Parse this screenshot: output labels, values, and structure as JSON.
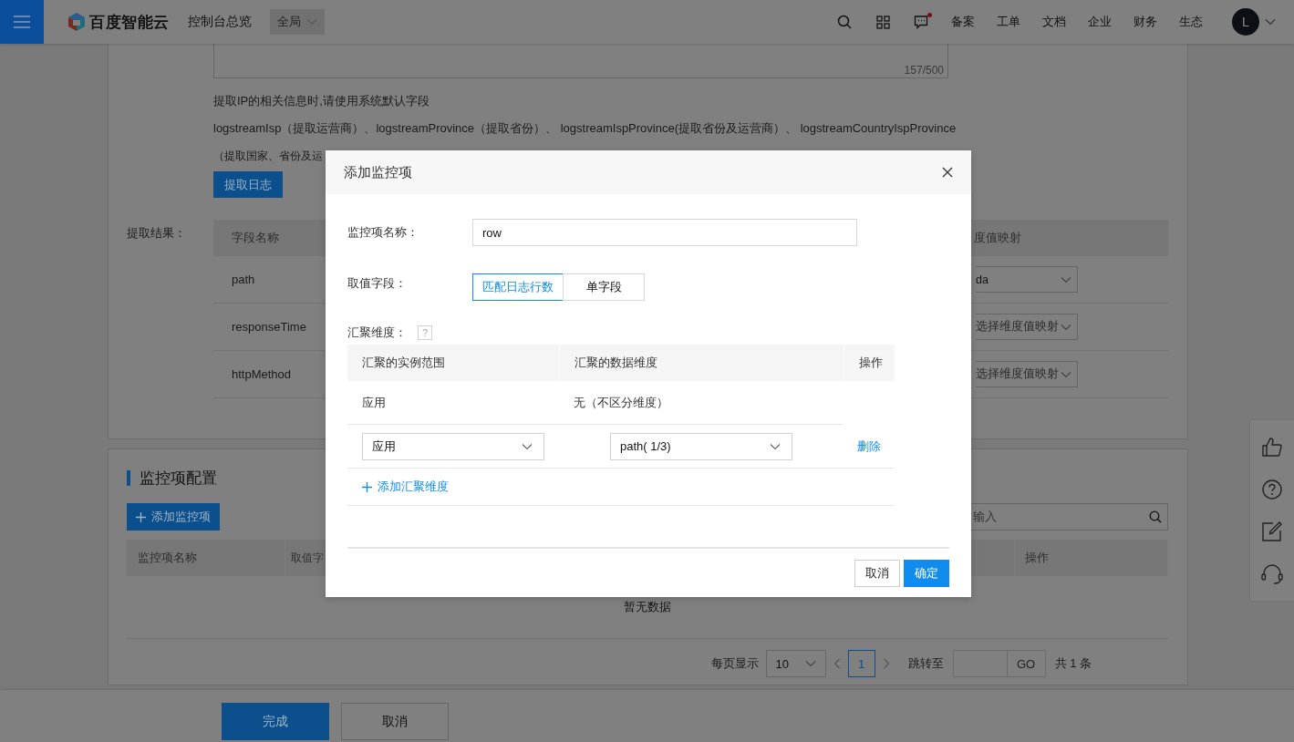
{
  "topbar": {
    "brand": "百度智能云",
    "title": "控制台总览",
    "scope": "全局",
    "notification_dot": true,
    "links": [
      "备案",
      "工单",
      "文档",
      "企业",
      "财务",
      "生态"
    ],
    "avatar": "L"
  },
  "log_form": {
    "char_count": "157/500",
    "hint": "提取IP的相关信息时,请使用系统默认字段",
    "fields_line": "logstreamIsp（提取运营商）、logstreamProvince（提取省份）、 logstreamIspProvince(提取省份及运营商）、 logstreamCountryIspProvince",
    "fields_line_2": "（提取国家、省份及运",
    "extract_button": "提取日志"
  },
  "extract_result": {
    "label": "提取结果：",
    "columns": [
      "字段名称",
      "度值映射"
    ],
    "rows": [
      {
        "field": "path",
        "mapping": {
          "kind": "value",
          "text": "da"
        }
      },
      {
        "field": "responseTime",
        "mapping": {
          "kind": "placeholder",
          "text": "选择维度值映射"
        }
      },
      {
        "field": "httpMethod",
        "mapping": {
          "kind": "placeholder",
          "text": "选择维度值映射"
        }
      }
    ]
  },
  "monitor_config": {
    "title": "监控项配置",
    "add_button": "添加监控项",
    "search": {
      "placeholder": "输入"
    },
    "columns": [
      "监控项名称",
      "取值字",
      "操作"
    ],
    "empty_text": "暂无数据",
    "pagination": {
      "page_size_label": "每页显示",
      "page_size": "10",
      "pages": [
        {
          "label": "1",
          "selected": true
        }
      ],
      "jump_label": "跳转至",
      "go_button": "GO",
      "total": "共 1 条"
    }
  },
  "footer_buttons": [
    {
      "label": "完成",
      "kind": "primary"
    },
    {
      "label": "取消",
      "kind": "default"
    }
  ],
  "dialog": {
    "title": "添加监控项",
    "name_field": {
      "label": "监控项名称：",
      "value": "row"
    },
    "value_field": {
      "label": "取值字段：",
      "options": [
        {
          "label": "匹配日志行数",
          "selected": true
        },
        {
          "label": "单字段",
          "selected": false
        }
      ]
    },
    "aggregation": {
      "label": "汇聚维度：",
      "help": "?",
      "columns": [
        "汇聚的实例范围",
        "汇聚的数据维度",
        "操作"
      ],
      "rows": [
        {
          "kind": "static",
          "scope": "应用",
          "dimension": "无（不区分维度）"
        },
        {
          "kind": "editable",
          "scope": "应用",
          "dimension": "path( 1/3)",
          "action": "删除"
        }
      ],
      "add_link": "添加汇聚维度"
    },
    "buttons": [
      {
        "label": "取消",
        "kind": "default"
      },
      {
        "label": "确定",
        "kind": "primary"
      }
    ]
  }
}
